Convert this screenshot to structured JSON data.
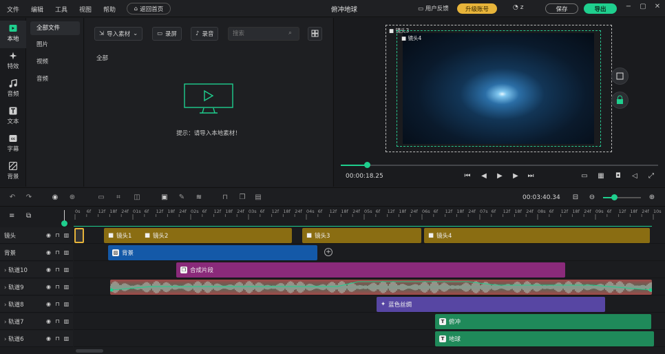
{
  "menu": [
    "文件",
    "编辑",
    "工具",
    "视图",
    "帮助"
  ],
  "header": {
    "home_button": "返回首页",
    "title": "俯冲地球",
    "feedback": "用户反馈",
    "upgrade": "升级账号",
    "user": "z",
    "save": "保存",
    "export": "导出",
    "colors": {
      "accent": "#1fcf8e",
      "upgrade": "#e7b43a"
    }
  },
  "sidebar": {
    "items": [
      {
        "label": "本地",
        "icon": "media-icon"
      },
      {
        "label": "特效",
        "icon": "effects-icon"
      },
      {
        "label": "音频",
        "icon": "music-icon"
      },
      {
        "label": "文本",
        "icon": "text-icon"
      },
      {
        "label": "字幕",
        "icon": "subtitle-icon"
      },
      {
        "label": "背景",
        "icon": "background-icon"
      }
    ]
  },
  "subnav": [
    "全部文件",
    "图片",
    "视频",
    "音频"
  ],
  "media": {
    "import": "导入素材",
    "record_screen": "录屏",
    "record_audio": "录音",
    "search_placeholder": "搜索",
    "section": "全部",
    "hint": "提示：请导入本地素材！"
  },
  "preview": {
    "cam_outer": "镜头3",
    "cam_inner": "镜头4",
    "current_time": "00:00:18.25",
    "progress": 0.08
  },
  "timeline": {
    "total_time": "00:03:40.34",
    "zoom": 0.25,
    "ruler": [
      "0s",
      "6f",
      "12f",
      "18f",
      "24f",
      "01s",
      "6f",
      "12f",
      "18f",
      "24f",
      "02s",
      "6f",
      "12f",
      "18f",
      "24f",
      "03s",
      "6f",
      "12f",
      "18f",
      "24f",
      "04s",
      "6f",
      "12f",
      "18f",
      "24f",
      "05s",
      "6f",
      "12f",
      "18f",
      "24f",
      "06s",
      "6f",
      "12f",
      "18f",
      "24f",
      "07s",
      "6f",
      "12f",
      "18f",
      "24f",
      "08s",
      "6f",
      "12f",
      "18f",
      "24f",
      "09s",
      "6f",
      "12f",
      "18f",
      "24f",
      "10s"
    ],
    "tracks": [
      {
        "name": "镜头"
      },
      {
        "name": "背景"
      },
      {
        "name": "轨道10"
      },
      {
        "name": "轨道9"
      },
      {
        "name": "轨道8"
      },
      {
        "name": "轨道7"
      },
      {
        "name": "轨道6"
      }
    ],
    "clips": {
      "cam1": "镜头1",
      "cam2": "镜头2",
      "cam3": "镜头3",
      "cam4": "镜头4",
      "bg": "背景",
      "comp": "合成片段",
      "fx": "蓝色丝绸",
      "text1": "俯冲",
      "text2": "地球"
    }
  }
}
